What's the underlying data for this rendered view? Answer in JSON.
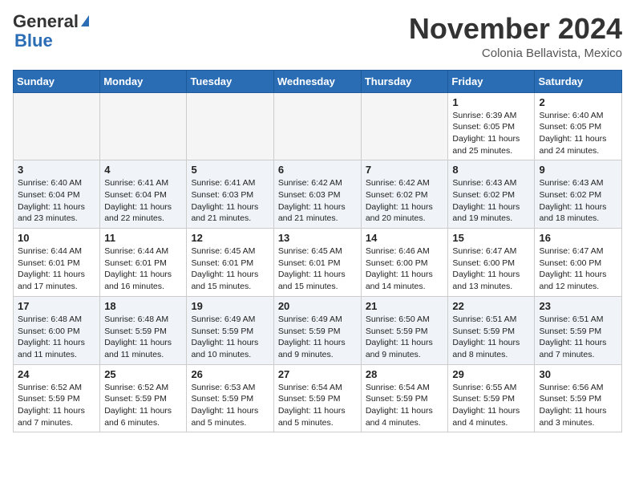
{
  "header": {
    "logo_general": "General",
    "logo_blue": "Blue",
    "month_title": "November 2024",
    "location": "Colonia Bellavista, Mexico"
  },
  "calendar": {
    "weekdays": [
      "Sunday",
      "Monday",
      "Tuesday",
      "Wednesday",
      "Thursday",
      "Friday",
      "Saturday"
    ],
    "weeks": [
      [
        {
          "day": "",
          "info": ""
        },
        {
          "day": "",
          "info": ""
        },
        {
          "day": "",
          "info": ""
        },
        {
          "day": "",
          "info": ""
        },
        {
          "day": "",
          "info": ""
        },
        {
          "day": "1",
          "info": "Sunrise: 6:39 AM\nSunset: 6:05 PM\nDaylight: 11 hours\nand 25 minutes."
        },
        {
          "day": "2",
          "info": "Sunrise: 6:40 AM\nSunset: 6:05 PM\nDaylight: 11 hours\nand 24 minutes."
        }
      ],
      [
        {
          "day": "3",
          "info": "Sunrise: 6:40 AM\nSunset: 6:04 PM\nDaylight: 11 hours\nand 23 minutes."
        },
        {
          "day": "4",
          "info": "Sunrise: 6:41 AM\nSunset: 6:04 PM\nDaylight: 11 hours\nand 22 minutes."
        },
        {
          "day": "5",
          "info": "Sunrise: 6:41 AM\nSunset: 6:03 PM\nDaylight: 11 hours\nand 21 minutes."
        },
        {
          "day": "6",
          "info": "Sunrise: 6:42 AM\nSunset: 6:03 PM\nDaylight: 11 hours\nand 21 minutes."
        },
        {
          "day": "7",
          "info": "Sunrise: 6:42 AM\nSunset: 6:02 PM\nDaylight: 11 hours\nand 20 minutes."
        },
        {
          "day": "8",
          "info": "Sunrise: 6:43 AM\nSunset: 6:02 PM\nDaylight: 11 hours\nand 19 minutes."
        },
        {
          "day": "9",
          "info": "Sunrise: 6:43 AM\nSunset: 6:02 PM\nDaylight: 11 hours\nand 18 minutes."
        }
      ],
      [
        {
          "day": "10",
          "info": "Sunrise: 6:44 AM\nSunset: 6:01 PM\nDaylight: 11 hours\nand 17 minutes."
        },
        {
          "day": "11",
          "info": "Sunrise: 6:44 AM\nSunset: 6:01 PM\nDaylight: 11 hours\nand 16 minutes."
        },
        {
          "day": "12",
          "info": "Sunrise: 6:45 AM\nSunset: 6:01 PM\nDaylight: 11 hours\nand 15 minutes."
        },
        {
          "day": "13",
          "info": "Sunrise: 6:45 AM\nSunset: 6:01 PM\nDaylight: 11 hours\nand 15 minutes."
        },
        {
          "day": "14",
          "info": "Sunrise: 6:46 AM\nSunset: 6:00 PM\nDaylight: 11 hours\nand 14 minutes."
        },
        {
          "day": "15",
          "info": "Sunrise: 6:47 AM\nSunset: 6:00 PM\nDaylight: 11 hours\nand 13 minutes."
        },
        {
          "day": "16",
          "info": "Sunrise: 6:47 AM\nSunset: 6:00 PM\nDaylight: 11 hours\nand 12 minutes."
        }
      ],
      [
        {
          "day": "17",
          "info": "Sunrise: 6:48 AM\nSunset: 6:00 PM\nDaylight: 11 hours\nand 11 minutes."
        },
        {
          "day": "18",
          "info": "Sunrise: 6:48 AM\nSunset: 5:59 PM\nDaylight: 11 hours\nand 11 minutes."
        },
        {
          "day": "19",
          "info": "Sunrise: 6:49 AM\nSunset: 5:59 PM\nDaylight: 11 hours\nand 10 minutes."
        },
        {
          "day": "20",
          "info": "Sunrise: 6:49 AM\nSunset: 5:59 PM\nDaylight: 11 hours\nand 9 minutes."
        },
        {
          "day": "21",
          "info": "Sunrise: 6:50 AM\nSunset: 5:59 PM\nDaylight: 11 hours\nand 9 minutes."
        },
        {
          "day": "22",
          "info": "Sunrise: 6:51 AM\nSunset: 5:59 PM\nDaylight: 11 hours\nand 8 minutes."
        },
        {
          "day": "23",
          "info": "Sunrise: 6:51 AM\nSunset: 5:59 PM\nDaylight: 11 hours\nand 7 minutes."
        }
      ],
      [
        {
          "day": "24",
          "info": "Sunrise: 6:52 AM\nSunset: 5:59 PM\nDaylight: 11 hours\nand 7 minutes."
        },
        {
          "day": "25",
          "info": "Sunrise: 6:52 AM\nSunset: 5:59 PM\nDaylight: 11 hours\nand 6 minutes."
        },
        {
          "day": "26",
          "info": "Sunrise: 6:53 AM\nSunset: 5:59 PM\nDaylight: 11 hours\nand 5 minutes."
        },
        {
          "day": "27",
          "info": "Sunrise: 6:54 AM\nSunset: 5:59 PM\nDaylight: 11 hours\nand 5 minutes."
        },
        {
          "day": "28",
          "info": "Sunrise: 6:54 AM\nSunset: 5:59 PM\nDaylight: 11 hours\nand 4 minutes."
        },
        {
          "day": "29",
          "info": "Sunrise: 6:55 AM\nSunset: 5:59 PM\nDaylight: 11 hours\nand 4 minutes."
        },
        {
          "day": "30",
          "info": "Sunrise: 6:56 AM\nSunset: 5:59 PM\nDaylight: 11 hours\nand 3 minutes."
        }
      ]
    ]
  }
}
